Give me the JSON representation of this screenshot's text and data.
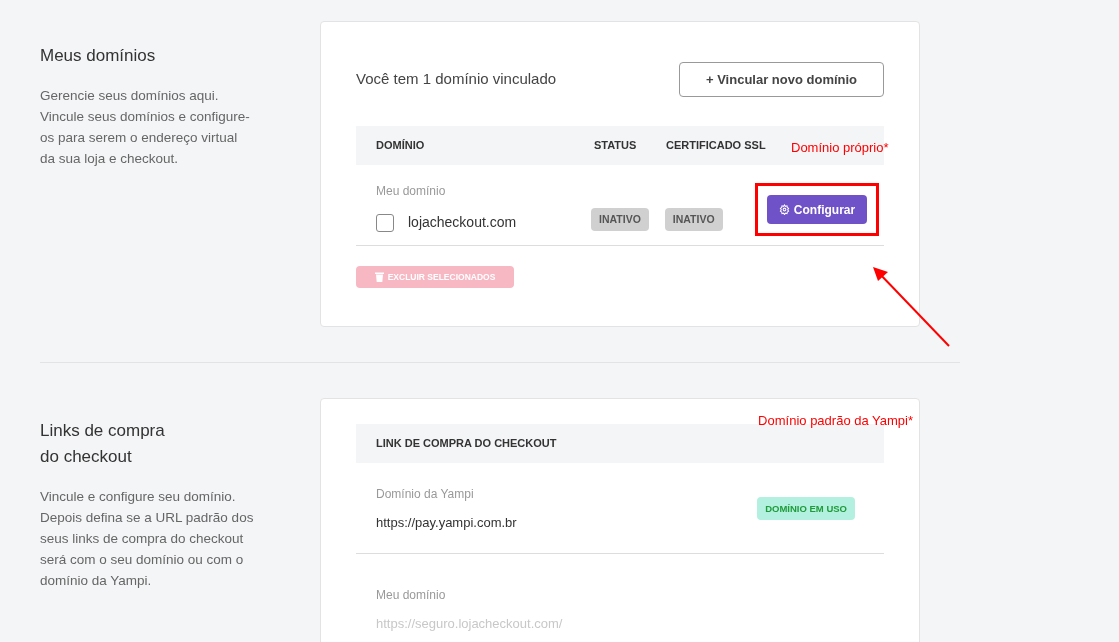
{
  "sections": [
    {
      "title_lines": [
        "Meus domínios"
      ],
      "description_lines": [
        "Gerencie seus domínios aqui.",
        "Vincule seus domínios e configure-",
        "os para serem o endereço virtual",
        "da sua loja e checkout."
      ],
      "summary": "Você tem 1 domínio vinculado",
      "add_button": "+ Vincular novo domínio",
      "columns": [
        "DOMÍNIO",
        "STATUS",
        "CERTIFICADO SSL"
      ],
      "annotation": "Domínio próprio*",
      "rows": [
        {
          "label": "Meu domínio",
          "domain": "lojacheckout.com",
          "checked": false,
          "status": "INATIVO",
          "ssl": "INATIVO",
          "action": "Configurar",
          "highlighted": true
        }
      ],
      "delete_button": {
        "label": "EXCLUIR SELECIONADOS",
        "disabled": true
      }
    },
    {
      "title_lines": [
        "Links de compra",
        "do checkout"
      ],
      "description_lines": [
        "Vincule e configure seu domínio.",
        "Depois defina se a URL padrão dos",
        "seus links de compra do checkout",
        "será com o seu domínio ou com o",
        "domínio da Yampi."
      ],
      "header": "LINK DE COMPRA DO CHECKOUT",
      "annotation": "Domínio padrão da Yampi*",
      "links": [
        {
          "label": "Domínio da Yampi",
          "url": "https://pay.yampi.com.br",
          "in_use": true,
          "badge": "DOMÍNIO EM USO"
        },
        {
          "label": "Meu domínio",
          "url": "https://seguro.lojacheckout.com/",
          "in_use": false
        }
      ]
    }
  ]
}
